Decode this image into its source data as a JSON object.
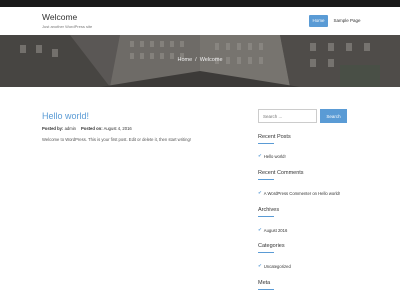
{
  "site": {
    "title": "Welcome",
    "tagline": "Just another WordPress site"
  },
  "nav": {
    "items": [
      {
        "label": "Home",
        "active": true
      },
      {
        "label": "Sample Page",
        "active": false
      }
    ]
  },
  "hero": {
    "breadcrumb": [
      "Home",
      "Welcome"
    ],
    "separator": "/"
  },
  "post": {
    "title": "Hello world!",
    "posted_by_label": "Posted by:",
    "author": "admin",
    "posted_on_label": "Posted on:",
    "date": "August 4, 2016",
    "body": "Welcome to WordPress. This is your first post. Edit or delete it, then start writing!"
  },
  "sidebar": {
    "search_placeholder": "Search ...",
    "search_button": "Search",
    "widgets": [
      {
        "title": "Recent Posts",
        "items": [
          "Hello world!"
        ]
      },
      {
        "title": "Recent Comments",
        "items": [
          "A WordPress Commenter on Hello world!"
        ]
      },
      {
        "title": "Archives",
        "items": [
          "August 2016"
        ]
      },
      {
        "title": "Categories",
        "items": [
          "Uncategorized"
        ]
      },
      {
        "title": "Meta",
        "items": []
      }
    ]
  },
  "colors": {
    "accent": "#5a9bd5",
    "topbar": "#1a1a1a"
  },
  "icons": {
    "list_bullet": "check-icon"
  }
}
